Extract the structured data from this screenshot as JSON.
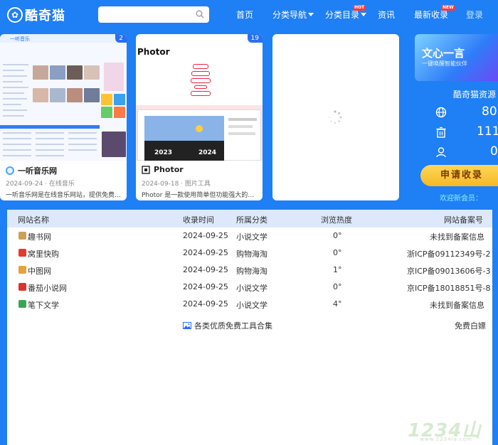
{
  "header": {
    "logo_text": "酷奇猫",
    "search_placeholder": "",
    "nav": [
      {
        "label": "首页"
      },
      {
        "label": "分类导航"
      },
      {
        "label": "分类目录",
        "badge": "HOT"
      },
      {
        "label": "资讯"
      },
      {
        "label": "最新收录",
        "badge": "NEW"
      },
      {
        "label": "登录"
      }
    ]
  },
  "cards": [
    {
      "count": "2",
      "title": "一听音乐网",
      "date": "2024-09-24",
      "category": "在线音乐",
      "meta": "2024-09-24 · 在线音乐",
      "desc": "一听音乐网是在线音乐网站，提供免费歌曲...",
      "thumb_label": "一听音乐"
    },
    {
      "count": "19",
      "title": "Photor",
      "date": "2024-09-18",
      "category": "图片工具",
      "meta": "2024-09-18 · 图片工具",
      "desc": "Photor 是一款使用简单但功能强大的截图工具",
      "thumb_heading": "Photor",
      "thumb_year_a": "2023",
      "thumb_year_b": "2024"
    },
    {
      "loading": true
    }
  ],
  "sidebar": {
    "promo_title": "文心一言",
    "promo_sub": "一键唤醒智能伙伴",
    "site_title": "酷奇猫资源",
    "stats": [
      {
        "icon": "globe-icon",
        "value": "80"
      },
      {
        "icon": "trash-icon",
        "value": "111"
      },
      {
        "icon": "user-icon",
        "value": "0"
      }
    ],
    "apply_label": "申请收录",
    "welcome": "欢迎新会员："
  },
  "table": {
    "headers": [
      "网站名称",
      "收录时间",
      "所属分类",
      "浏览热度",
      "网站备案号"
    ],
    "rows": [
      {
        "name": "趣书网",
        "date": "2024-09-25",
        "category": "小说文学",
        "heat": "0°",
        "icp": "未找到备案信息",
        "color": "#c9a15a"
      },
      {
        "name": "窝里快购",
        "date": "2024-09-25",
        "category": "购物海淘",
        "heat": "0°",
        "icp": "浙ICP备09112349号-2",
        "color": "#e23b2e"
      },
      {
        "name": "中图网",
        "date": "2024-09-25",
        "category": "购物海淘",
        "heat": "1°",
        "icp": "京ICP备09013606号-3",
        "color": "#e6a23c"
      },
      {
        "name": "番茄小说网",
        "date": "2024-09-25",
        "category": "小说文学",
        "heat": "0°",
        "icp": "京ICP备18018851号-8",
        "color": "#e0312c"
      },
      {
        "name": "笔下文学",
        "date": "2024-09-25",
        "category": "小说文学",
        "heat": "4°",
        "icp": "未找到备案信息",
        "color": "#3aa655"
      }
    ],
    "footer_link": "各类优质免费工具合集",
    "footer_right": "免费白嫖"
  },
  "watermark": {
    "main": "1234山",
    "sub": "www.1234la.com"
  }
}
